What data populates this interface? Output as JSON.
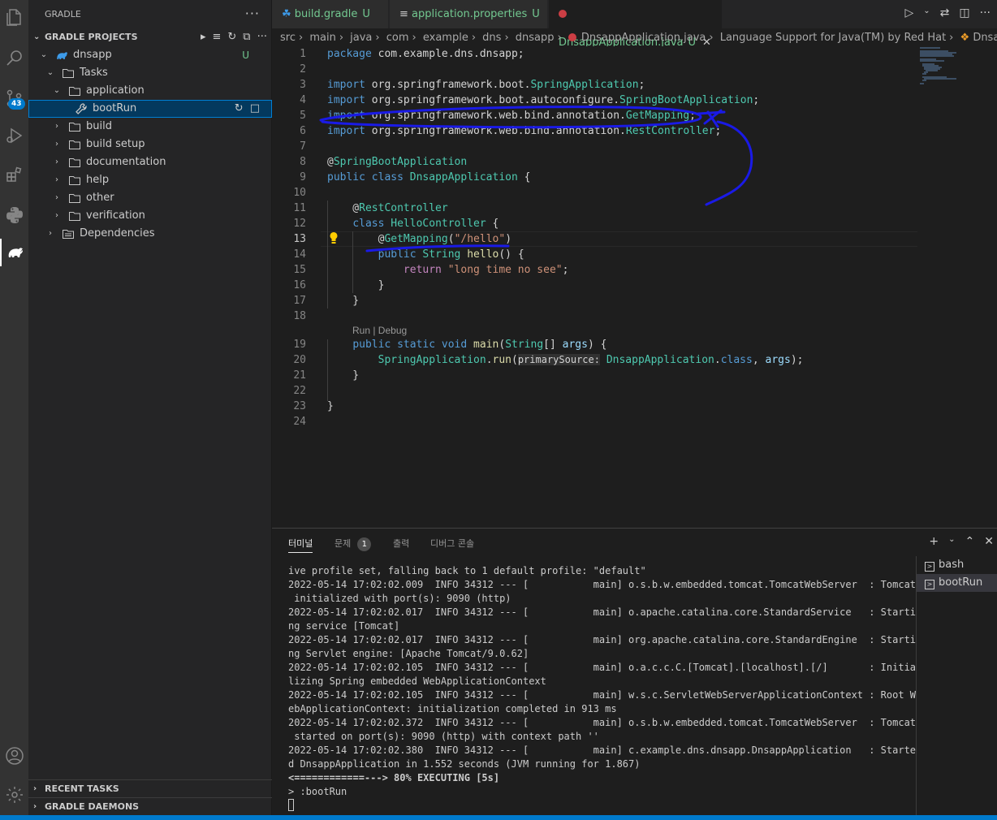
{
  "activity": {
    "scm_badge": "43",
    "colors": {
      "bar": "#333333",
      "accent": "#007acc"
    }
  },
  "sidebar": {
    "header": "GRADLE",
    "projects_title": "GRADLE PROJECTS",
    "tree": [
      {
        "label": "dnsapp",
        "marker": "U"
      },
      {
        "label": "Tasks"
      },
      {
        "label": "application"
      },
      {
        "label": "bootRun"
      },
      {
        "label": "build"
      },
      {
        "label": "build setup"
      },
      {
        "label": "documentation"
      },
      {
        "label": "help"
      },
      {
        "label": "other"
      },
      {
        "label": "verification"
      },
      {
        "label": "Dependencies"
      }
    ],
    "recent_tasks": "RECENT TASKS",
    "gradle_daemons": "GRADLE DAEMONS"
  },
  "tabs": [
    {
      "label": "build.gradle",
      "marker": "U"
    },
    {
      "label": "application.properties",
      "marker": "U"
    },
    {
      "label": "DnsappApplication.java",
      "marker": "U"
    }
  ],
  "breadcrumb": [
    "src",
    "main",
    "java",
    "com",
    "example",
    "dns",
    "dnsapp",
    "DnsappApplication.java",
    "Language Support for Java(TM) by Red Hat",
    "DnsappApplication"
  ],
  "editor": {
    "line_numbers": [
      "1",
      "2",
      "3",
      "4",
      "5",
      "6",
      "7",
      "8",
      "9",
      "10",
      "11",
      "12",
      "13",
      "14",
      "15",
      "16",
      "17",
      "18",
      "19",
      "20",
      "21",
      "22",
      "23",
      "24"
    ],
    "codelens": "Run | Debug",
    "current_line": "13"
  },
  "panel": {
    "tabs": [
      "터미널",
      "문제",
      "출력",
      "디버그 콘솔"
    ],
    "problems_count": "1",
    "terminal_lines": [
      "ive profile set, falling back to 1 default profile: \"default\"",
      "2022-05-14 17:02:02.009  INFO 34312 --- [           main] o.s.b.w.embedded.tomcat.TomcatWebServer  : Tomcat",
      " initialized with port(s): 9090 (http)",
      "2022-05-14 17:02:02.017  INFO 34312 --- [           main] o.apache.catalina.core.StandardService   : Starti",
      "ng service [Tomcat]",
      "2022-05-14 17:02:02.017  INFO 34312 --- [           main] org.apache.catalina.core.StandardEngine  : Starti",
      "ng Servlet engine: [Apache Tomcat/9.0.62]",
      "2022-05-14 17:02:02.105  INFO 34312 --- [           main] o.a.c.c.C.[Tomcat].[localhost].[/]       : Initia",
      "lizing Spring embedded WebApplicationContext",
      "2022-05-14 17:02:02.105  INFO 34312 --- [           main] w.s.c.ServletWebServerApplicationContext : Root W",
      "ebApplicationContext: initialization completed in 913 ms",
      "2022-05-14 17:02:02.372  INFO 34312 --- [           main] o.s.b.w.embedded.tomcat.TomcatWebServer  : Tomcat",
      " started on port(s): 9090 (http) with context path ''",
      "2022-05-14 17:02:02.380  INFO 34312 --- [           main] c.example.dns.dnsapp.DnsappApplication   : Starte",
      "d DnsappApplication in 1.552 seconds (JVM running for 1.867)"
    ],
    "progress_line": "<============---> 80% EXECUTING [5s]",
    "prompt_line": "> :bootRun",
    "terminals": [
      "bash",
      "bootRun"
    ]
  }
}
